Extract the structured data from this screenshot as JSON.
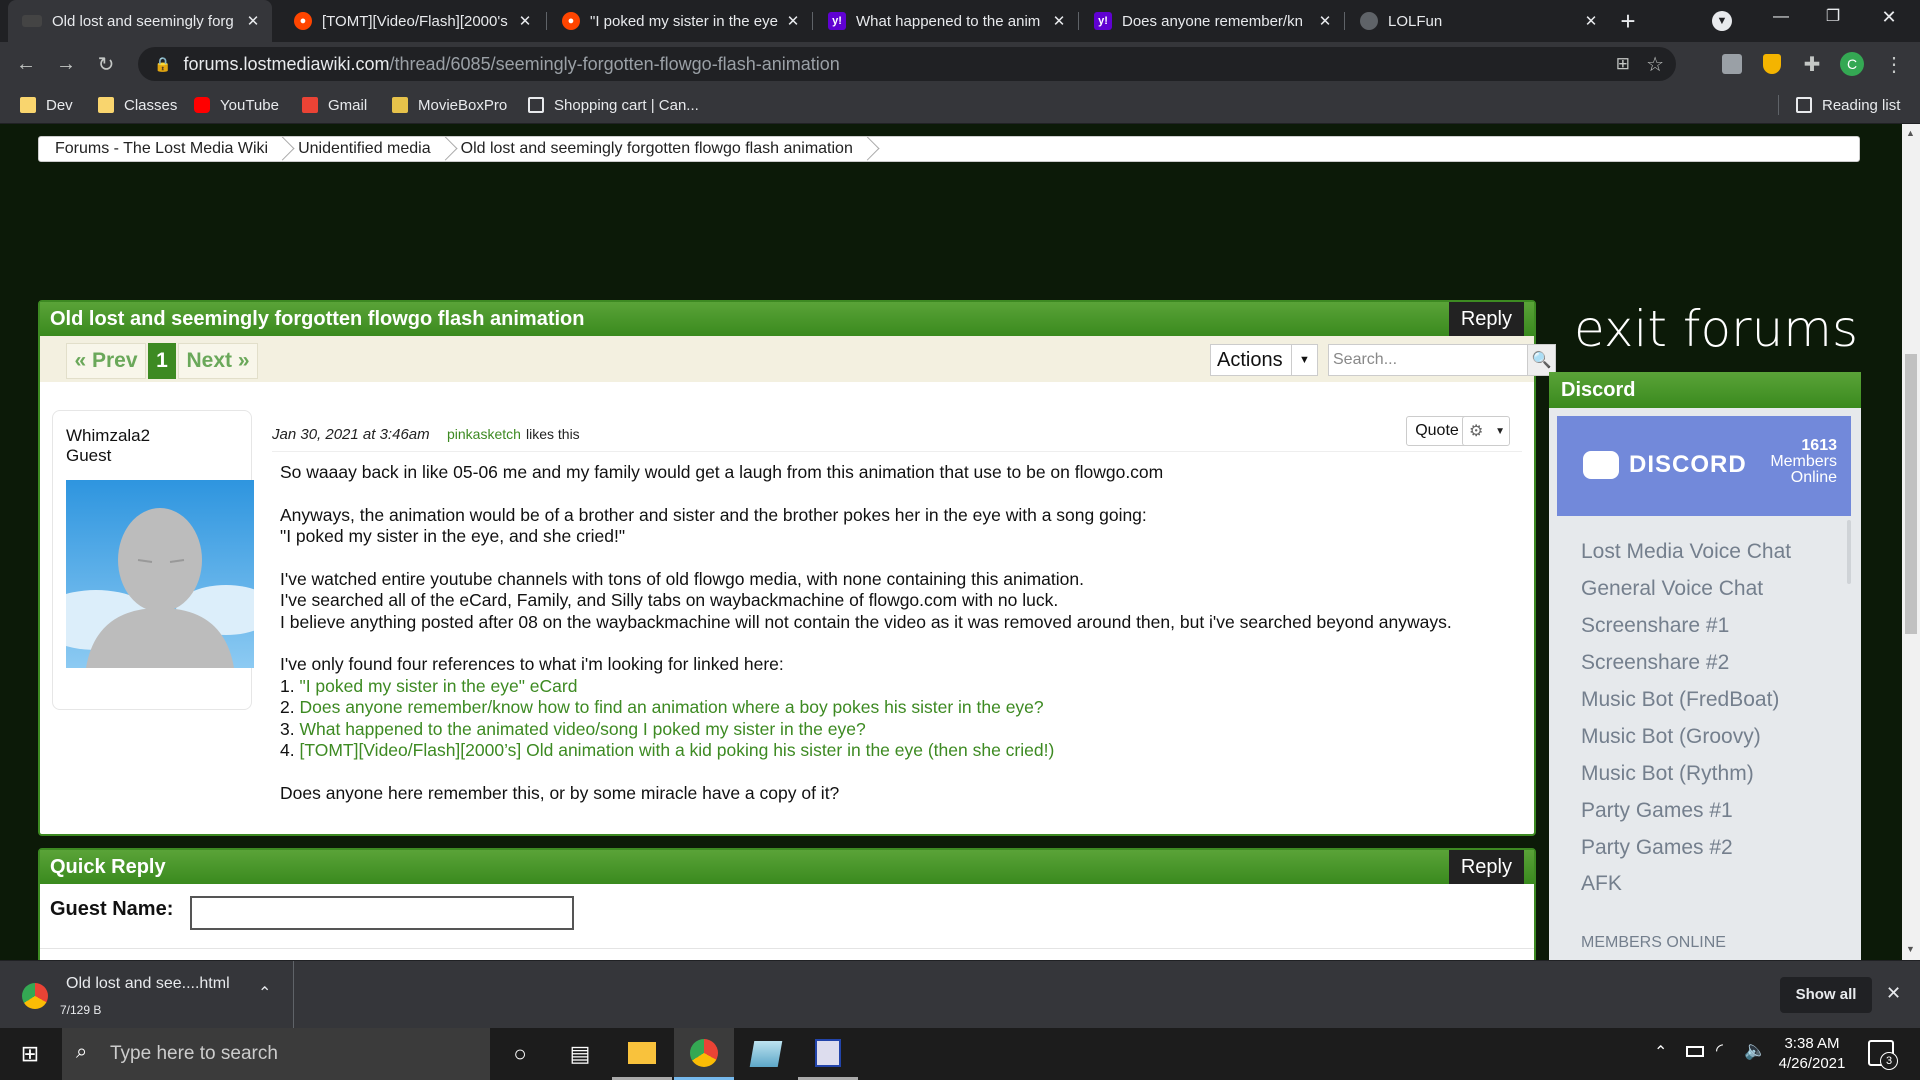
{
  "browser": {
    "tabs": [
      {
        "title": "Old lost and seemingly forg",
        "active": true
      },
      {
        "title": "[TOMT][Video/Flash][2000's"
      },
      {
        "title": "\"I poked my sister in the eye"
      },
      {
        "title": "What happened to the anim"
      },
      {
        "title": "Does anyone remember/kn"
      },
      {
        "title": "LOLFun"
      }
    ],
    "url_host": "forums.lostmediawiki.com",
    "url_path": "/thread/6085/seemingly-forgotten-flowgo-flash-animation",
    "profile_initial": "C",
    "bookmarks": [
      "Dev",
      "Classes",
      "YouTube",
      "Gmail",
      "MovieBoxPro",
      "Shopping cart | Can..."
    ],
    "reading_list": "Reading list"
  },
  "breadcrumb": [
    "Forums - The Lost Media Wiki",
    "Unidentified media",
    "Old lost and seemingly forgotten flowgo flash animation"
  ],
  "thread": {
    "title": "Old lost and seemingly forgotten flowgo flash animation",
    "reply": "Reply",
    "prev": "« Prev",
    "page": "1",
    "next": "Next »",
    "actions": "Actions",
    "search_placeholder": "Search..."
  },
  "post": {
    "author": "Whimzala2",
    "role": "Guest",
    "date": "Jan 30, 2021 at 3:46am",
    "liker": "pinkasketch",
    "likes_suffix": "likes this",
    "quote": "Quote",
    "p1": "So waaay back in like 05-06 me and my family would get a laugh from this animation that use to be on flowgo.com",
    "p2a": "Anyways, the animation would be of a brother and sister and the brother pokes her in the eye with a song going:",
    "p2b": "\"I poked my sister in the eye, and she cried!\"",
    "p3a": "I've watched entire youtube channels with tons of old flowgo media, with none containing this animation.",
    "p3b": "I've searched all of the eCard, Family, and Silly tabs on waybackmachine of flowgo.com with no luck.",
    "p3c": "I believe anything posted after 08 on the waybackmachine will not contain the video as it was removed around then, but i've searched beyond anyways.",
    "p4": "I've only found four references to what i'm looking for linked here:",
    "links": [
      {
        "num": "1.",
        "text": "\"I poked my sister in the eye\" eCard"
      },
      {
        "num": "2.",
        "text": "Does anyone remember/know how to find an animation where a boy pokes his sister in the eye?"
      },
      {
        "num": "3.",
        "text": "What happened to the animated video/song I poked my sister in the eye?"
      },
      {
        "num": "4.",
        "text": "[TOMT][Video/Flash][2000’s] Old animation with a kid poking his sister in the eye (then she cried!)"
      }
    ],
    "p5": "Does anyone here remember this, or by some miracle have a copy of it?"
  },
  "quick_reply": {
    "title": "Quick Reply",
    "reply": "Reply",
    "guest_label": "Guest Name:"
  },
  "sidebar": {
    "exit": "exit forums",
    "discord_title": "Discord",
    "discord_logo": "DISCORD",
    "members_count": "1613",
    "members_label": "Members",
    "online_label": "Online",
    "channels": [
      "Lost Media Voice Chat",
      "General Voice Chat",
      "Screenshare #1",
      "Screenshare #2",
      "Music Bot (FredBoat)",
      "Music Bot (Groovy)",
      "Music Bot (Rythm)",
      "Party Games #1",
      "Party Games #2",
      "AFK"
    ],
    "members_online": "MEMBERS ONLINE"
  },
  "downloads": {
    "file": "Old lost and see....html",
    "size": "7/129 B",
    "show_all": "Show all"
  },
  "taskbar": {
    "search_placeholder": "Type here to search",
    "time": "3:38 AM",
    "date": "4/26/2021",
    "notifications": "3"
  },
  "colors": {
    "accent_green": "#3d8a22",
    "discord_blurple": "#7289da"
  }
}
